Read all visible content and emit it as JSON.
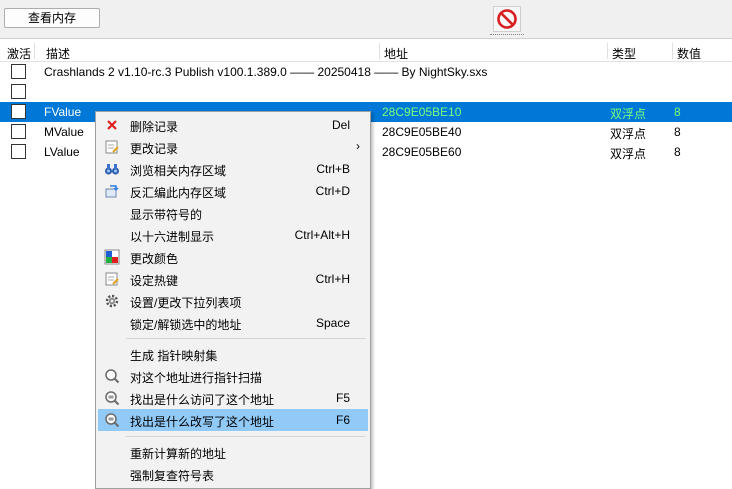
{
  "toolbar": {
    "view_memory_label": "查看内存"
  },
  "columns": {
    "active": "激活",
    "description": "描述",
    "address": "地址",
    "type": "类型",
    "value": "数值"
  },
  "rows": [
    {
      "description": "Crashlands 2 v1.10-rc.3 Publish v100.1.389.0 —— 20250418 —— By NightSky.sxs",
      "address": "",
      "type": "",
      "value": ""
    },
    {
      "description": "",
      "address": "",
      "type": "",
      "value": ""
    },
    {
      "description": "FValue",
      "address": "28C9E05BE10",
      "type": "双浮点",
      "value": "8"
    },
    {
      "description": "MValue",
      "address": "28C9E05BE40",
      "type": "双浮点",
      "value": "8"
    },
    {
      "description": "LValue",
      "address": "28C9E05BE60",
      "type": "双浮点",
      "value": "8"
    }
  ],
  "menu": {
    "items": [
      {
        "label": "删除记录",
        "shortcut": "Del",
        "icon": "delete-x-icon"
      },
      {
        "label": "更改记录",
        "shortcut": "",
        "icon": "edit-note-icon"
      },
      {
        "label": "浏览相关内存区域",
        "shortcut": "Ctrl+B",
        "icon": "binoculars-icon"
      },
      {
        "label": "反汇编此内存区域",
        "shortcut": "Ctrl+D",
        "icon": "disassemble-icon"
      },
      {
        "label": "显示带符号的",
        "shortcut": "",
        "icon": ""
      },
      {
        "label": "以十六进制显示",
        "shortcut": "Ctrl+Alt+H",
        "icon": ""
      },
      {
        "label": "更改颜色",
        "shortcut": "",
        "icon": "color-palette-icon"
      },
      {
        "label": "设定热键",
        "shortcut": "Ctrl+H",
        "icon": "hotkey-note-icon"
      },
      {
        "label": "设置/更改下拉列表项",
        "shortcut": "",
        "icon": "gear-icon"
      },
      {
        "label": "锁定/解锁选中的地址",
        "shortcut": "Space",
        "icon": ""
      },
      {
        "label": "生成 指针映射集",
        "shortcut": "",
        "icon": ""
      },
      {
        "label": "对这个地址进行指针扫描",
        "shortcut": "",
        "icon": "magnifier-icon"
      },
      {
        "label": "找出是什么访问了这个地址",
        "shortcut": "F5",
        "icon": "magnifier-access-icon"
      },
      {
        "label": "找出是什么改写了这个地址",
        "shortcut": "F6",
        "icon": "magnifier-write-icon"
      },
      {
        "label": "重新计算新的地址",
        "shortcut": "",
        "icon": ""
      },
      {
        "label": "强制复查符号表",
        "shortcut": "",
        "icon": ""
      }
    ],
    "submenu_arrow": "›"
  },
  "colors": {
    "selection": "#0078d7",
    "selected_value_text": "#7cff7c",
    "menu_highlight": "#91c9f7"
  }
}
